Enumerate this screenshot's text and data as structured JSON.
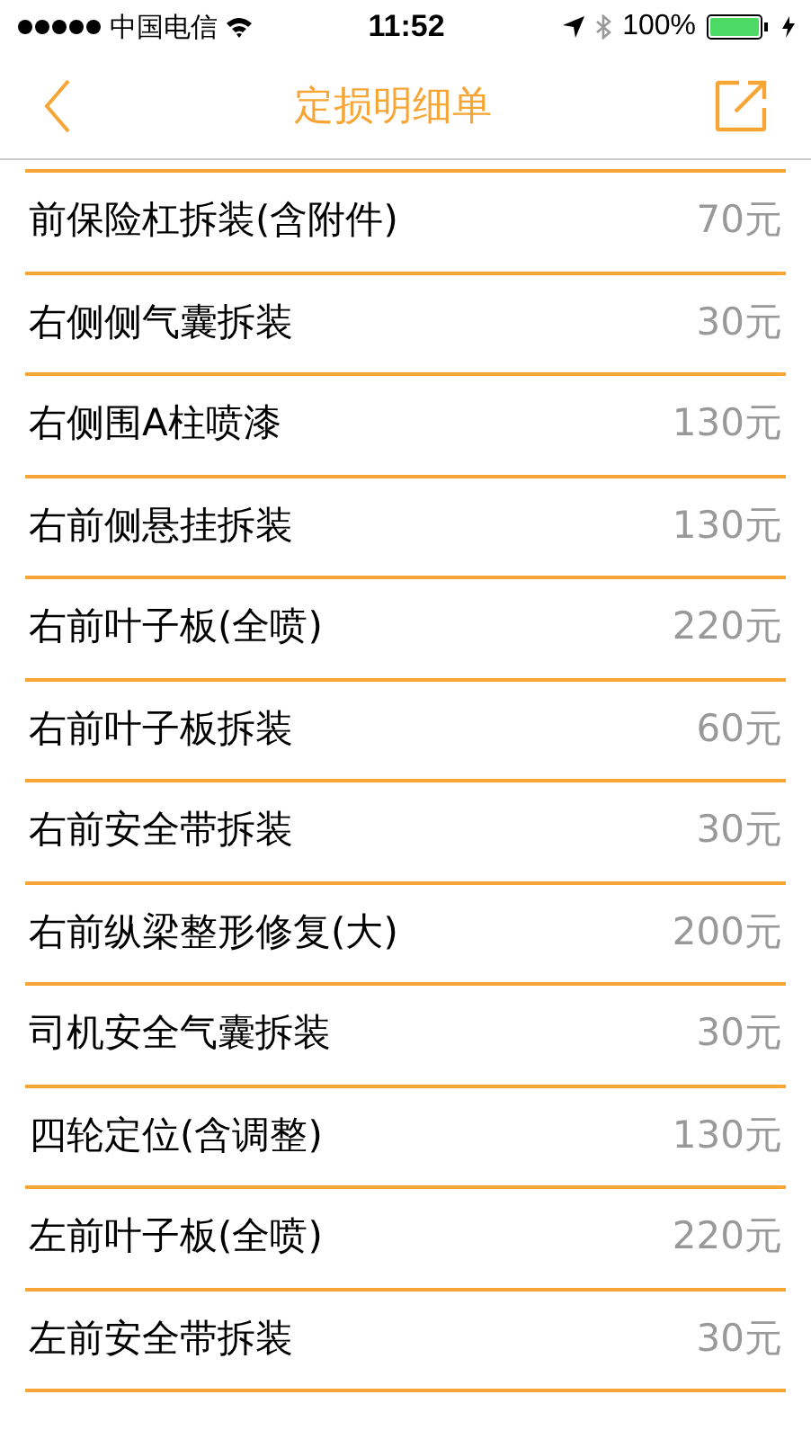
{
  "status_bar": {
    "carrier": "中国电信",
    "time": "11:52",
    "battery": "100%"
  },
  "nav": {
    "title": "定损明细单"
  },
  "items": [
    {
      "name": "前保险杠拆装(含附件)",
      "price": "70元"
    },
    {
      "name": "右侧侧气囊拆装",
      "price": "30元"
    },
    {
      "name": "右侧围A柱喷漆",
      "price": "130元"
    },
    {
      "name": "右前侧悬挂拆装",
      "price": "130元"
    },
    {
      "name": "右前叶子板(全喷)",
      "price": "220元"
    },
    {
      "name": "右前叶子板拆装",
      "price": "60元"
    },
    {
      "name": "右前安全带拆装",
      "price": "30元"
    },
    {
      "name": "右前纵梁整形修复(大)",
      "price": "200元"
    },
    {
      "name": "司机安全气囊拆装",
      "price": "30元"
    },
    {
      "name": "四轮定位(含调整)",
      "price": "130元"
    },
    {
      "name": "左前叶子板(全喷)",
      "price": "220元"
    },
    {
      "name": "左前安全带拆装",
      "price": "30元"
    }
  ]
}
